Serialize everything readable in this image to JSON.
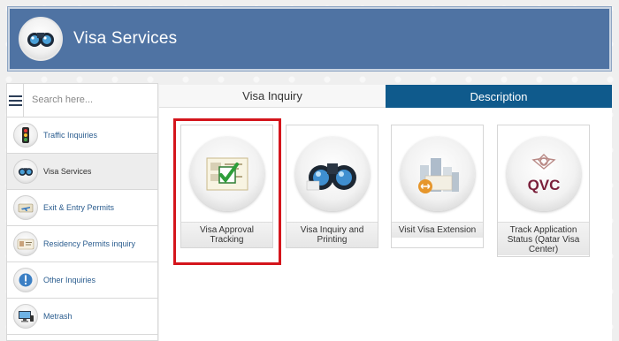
{
  "header": {
    "title": "Visa Services",
    "logo_icon": "binoculars-icon"
  },
  "sidebar": {
    "search_placeholder": "Search here...",
    "items": [
      {
        "label": "Traffic Inquiries",
        "icon": "traffic-light-icon",
        "active": false
      },
      {
        "label": "Visa Services",
        "icon": "binoculars-icon",
        "active": true
      },
      {
        "label": "Exit & Entry Permits",
        "icon": "airplane-icon",
        "active": false
      },
      {
        "label": "Residency Permits inquiry",
        "icon": "id-card-icon",
        "active": false
      },
      {
        "label": "Other Inquiries",
        "icon": "exclamation-icon",
        "active": false
      },
      {
        "label": "Metrash",
        "icon": "computer-icon",
        "active": false
      }
    ]
  },
  "tabs": [
    {
      "label": "Visa Inquiry",
      "active": true
    },
    {
      "label": "Description",
      "active": false
    }
  ],
  "cards": [
    {
      "label": "Visa Approval Tracking",
      "icon": "checklist-icon",
      "highlighted": true
    },
    {
      "label": "Visa Inquiry and Printing",
      "icon": "binoculars-icon",
      "highlighted": false
    },
    {
      "label": "Visit Visa Extension",
      "icon": "building-extension-icon",
      "highlighted": false
    },
    {
      "label": "Track Application Status (Qatar Visa Center)",
      "icon": "qvc-logo-icon",
      "highlighted": false
    }
  ],
  "colors": {
    "header_bg": "#4f73a3",
    "tab_active_bg": "#0f5a8c",
    "highlight": "#d4151c",
    "link": "#2b5d8f"
  }
}
